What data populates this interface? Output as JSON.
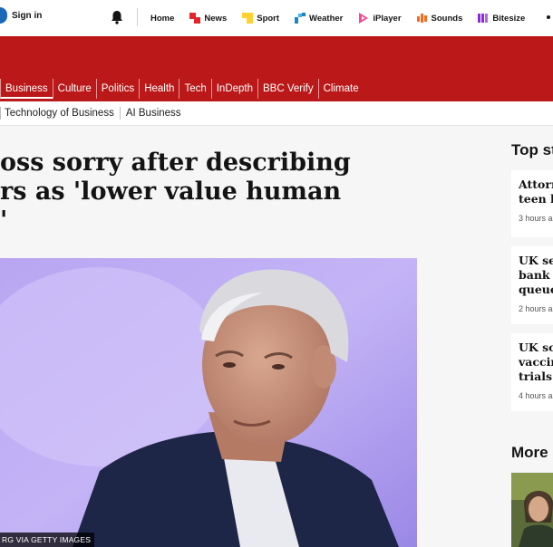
{
  "header": {
    "sign_in": "Sign in",
    "nav": [
      {
        "label": "Home",
        "icon": "home-icon",
        "color": ""
      },
      {
        "label": "News",
        "icon": "news-icon",
        "color": "#e4262b"
      },
      {
        "label": "Sport",
        "icon": "sport-icon",
        "color": "#ffd230"
      },
      {
        "label": "Weather",
        "icon": "weather-icon",
        "color": "#1a84c7"
      },
      {
        "label": "iPlayer",
        "icon": "iplayer-icon",
        "color": "#f54997"
      },
      {
        "label": "Sounds",
        "icon": "sounds-icon",
        "color": "#f66a1e"
      },
      {
        "label": "Bitesize",
        "icon": "bitesize-icon",
        "color": "#8d2cd6"
      }
    ]
  },
  "section_nav": [
    "Business",
    "Culture",
    "Politics",
    "Health",
    "Tech",
    "InDepth",
    "BBC Verify",
    "Climate"
  ],
  "sub_nav": [
    "Technology of Business",
    "AI Business"
  ],
  "article": {
    "headline_lines": [
      "oss sorry after describing",
      "rs as 'lower value human",
      "'"
    ],
    "image_credit": "RG VIA GETTY IMAGES"
  },
  "sidebar": {
    "top_title": "Top st",
    "stories": [
      {
        "lines": [
          "Attorn",
          "teen b"
        ],
        "time": "3 hours a"
      },
      {
        "lines": [
          "UK sec",
          "bank l",
          "queue"
        ],
        "time": "2 hours a"
      },
      {
        "lines": [
          "UK sci",
          "vaccin",
          "trials i"
        ],
        "time": "4 hours a"
      }
    ],
    "more_title": "More"
  },
  "colors": {
    "brand_red": "#bb1919",
    "sign_in_blue": "#1a69b8"
  }
}
